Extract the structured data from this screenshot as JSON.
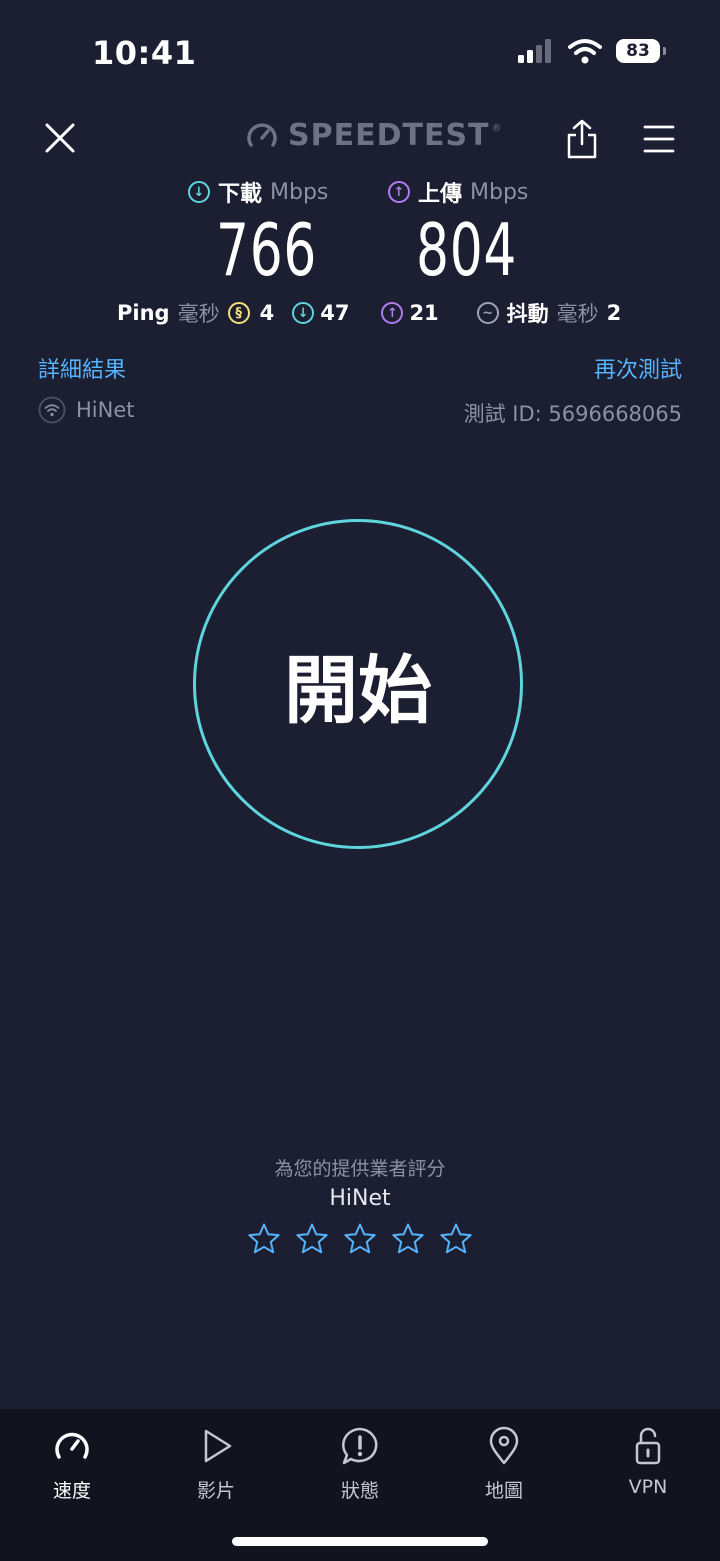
{
  "status_bar": {
    "time": "10:41",
    "battery": "83"
  },
  "header": {
    "logo_text": "SPEEDTEST",
    "logo_mark": "®"
  },
  "results": {
    "download": {
      "label": "下載",
      "unit": "Mbps",
      "value": "766"
    },
    "upload": {
      "label": "上傳",
      "unit": "Mbps",
      "value": "804"
    },
    "ping": {
      "label": "Ping",
      "unit": "毫秒",
      "idle": "4",
      "down": "47",
      "up": "21",
      "jitter_label": "抖動",
      "jitter_unit": "毫秒",
      "jitter": "2"
    }
  },
  "links": {
    "details": "詳細結果",
    "retest": "再次測試"
  },
  "connection": {
    "isp": "HiNet",
    "test_id_label": "測試 ID:",
    "test_id": "5696668065"
  },
  "start_button": {
    "label": "開始"
  },
  "rating": {
    "prompt": "為您的提供業者評分",
    "isp": "HiNet",
    "stars_selected": 0,
    "stars_total": 5
  },
  "tabs": [
    {
      "label": "速度",
      "icon": "speedometer-icon",
      "active": true
    },
    {
      "label": "影片",
      "icon": "play-icon",
      "active": false
    },
    {
      "label": "狀態",
      "icon": "alert-bubble-icon",
      "active": false
    },
    {
      "label": "地圖",
      "icon": "map-pin-icon",
      "active": false
    },
    {
      "label": "VPN",
      "icon": "lock-icon",
      "active": false
    }
  ],
  "colors": {
    "background": "#1c1e31",
    "download_accent": "#5ed5dd",
    "upload_accent": "#b27cf0",
    "ping_idle_accent": "#f3e17b",
    "link": "#56b3ff",
    "tab_bar": "#11131f"
  }
}
